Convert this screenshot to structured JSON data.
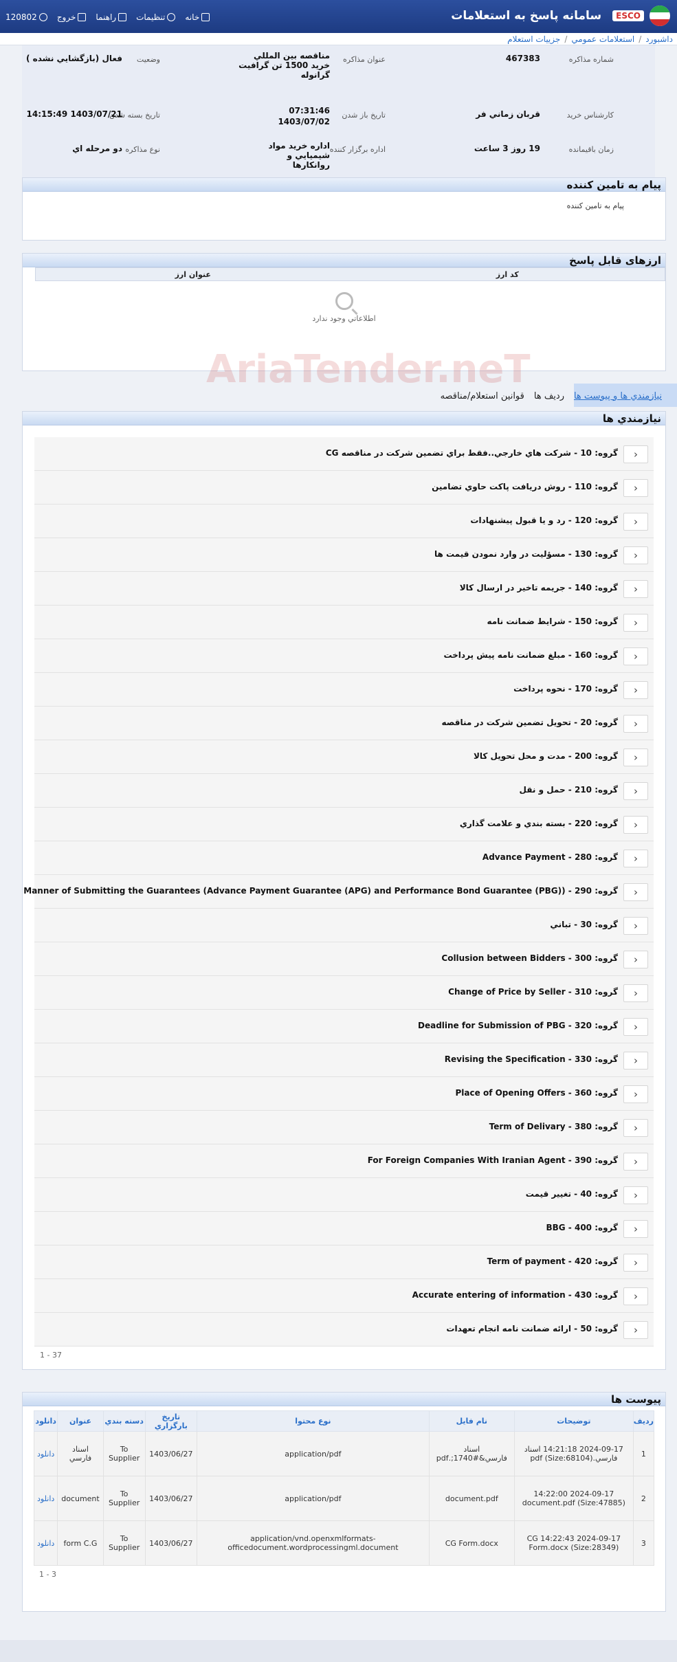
{
  "header": {
    "app_title": "سامانه پاسخ به استعلامات",
    "brand": "ESCO",
    "nav": {
      "home": "خانه",
      "settings": "تنظيمات",
      "help": "راهنما",
      "logout": "خروج",
      "user": "120802"
    }
  },
  "breadcrumb": [
    "داشبورد",
    "استعلامات عمومي",
    "جزييات استعلام"
  ],
  "info": {
    "number_label": "شماره مذاکره",
    "number": "467383",
    "title_label": "عنوان مذاکره",
    "title": "مناقصه بين المللي خريد 1500 تن گرافيت گرانوله",
    "status_label": "وضعيت",
    "status": "فعال (بازگشايي نشده )",
    "buyer_label": "کارشناس خريد",
    "buyer": "قربان زماني فر",
    "open_date_label": "تاريخ باز شدن",
    "open_date_time": "07:31:46",
    "open_date": "1403/07/02",
    "close_date_label": "تاريخ بسته شدن",
    "close_date": "1403/07/21 14:15:49",
    "remaining_label": "زمان باقيمانده",
    "remaining": "19 روز 3 ساعت",
    "dept_label": "اداره برگزار کننده",
    "dept": "اداره خريد مواد شيميايي و روانکارها",
    "type_label": "نوع مذاکره",
    "type": "دو مرحله اي"
  },
  "supplier_message": {
    "title": "پيام به تامين کننده",
    "body": "پيام به تامين کننده"
  },
  "currencies": {
    "title": "ارزهای قابل پاسخ",
    "col_code": "کد ارز",
    "col_title": "عنوان ارز",
    "empty": "اطلاعاتي وجود ندارد"
  },
  "tabs": [
    "نيازمندي ها و پيوست ها",
    "رديف ها",
    "قوانين استعلام/مناقصه"
  ],
  "requirements": {
    "title": "نيازمندي ها",
    "groups": [
      "گروه: 10 - شرکت هاي خارجي..فقط براي تضمين شرکت در مناقصه CG",
      "گروه: 110 - روش دريافت پاکت حاوي تضامين",
      "گروه: 120 - رد و يا قبول پيشنهادات",
      "گروه: 130 - مسؤليت در وارد نمودن قيمت ها",
      "گروه: 140 - جريمه تاخير در ارسال کالا",
      "گروه: 150 - شرايط ضمانت نامه",
      "گروه: 160 - مبلغ ضمانت نامه پيش پرداخت",
      "گروه: 170 - نحوه پرداخت",
      "گروه: 20 - تحويل تضمين شرکت در مناقصه",
      "گروه: 200 - مدت و محل تحويل کالا",
      "گروه: 210 - حمل و نقل",
      "گروه: 220 - بسته بندي و علامت گذاري",
      "گروه: 280 - Advance Payment",
      "گروه: 290 - Manner of Submitting the Guarantees (Advance Payment Guarantee (APG) and Performance Bond Guarantee (PBG))",
      "گروه: 30 - تباني",
      "گروه: 300 - Collusion between Bidders",
      "گروه: 310 - Change of Price by Seller",
      "گروه: 320 - Deadline for Submission of PBG",
      "گروه: 330 - Revising the Specification",
      "گروه: 360 - Place of Opening Offers",
      "گروه: 380 - Term of Delivary",
      "گروه: 390 - For Foreign Companies With Iranian Agent",
      "گروه: 40 - تغيير قيمت",
      "گروه: 400 - BBG",
      "گروه: 420 - Term of payment",
      "گروه: 430 - Accurate entering of information",
      "گروه: 50 - ارائه ضمانت نامه انجام تعهدات"
    ],
    "pager": "1 - 37"
  },
  "attachments": {
    "title": "پيوست ها",
    "columns": [
      "رديف",
      "توضيحات",
      "نام فايل",
      "نوع محتوا",
      "تاريخ بارگزاري",
      "دسته بندي",
      "عنوان",
      "دانلود"
    ],
    "rows": [
      [
        "1",
        "2024-09-17 14:21:18 اسناد فارسي.pdf (Size:68104)",
        "اسناد فارسي&#1740;.pdf",
        "application/pdf",
        "1403/06/27",
        "To Supplier",
        "اسناد فارسي",
        "دانلود"
      ],
      [
        "2",
        "2024-09-17 14:22:00 document.pdf (Size:47885)",
        "document.pdf",
        "application/pdf",
        "1403/06/27",
        "To Supplier",
        "document",
        "دانلود"
      ],
      [
        "3",
        "2024-09-17 14:22:43 CG Form.docx (Size:28349)",
        "CG Form.docx",
        "application/vnd.openxmlformats-officedocument.wordprocessingml.document",
        "1403/06/27",
        "To Supplier",
        "form C.G",
        "دانلود"
      ]
    ],
    "pager": "1 - 3"
  },
  "watermark": "AriaTender.neT"
}
